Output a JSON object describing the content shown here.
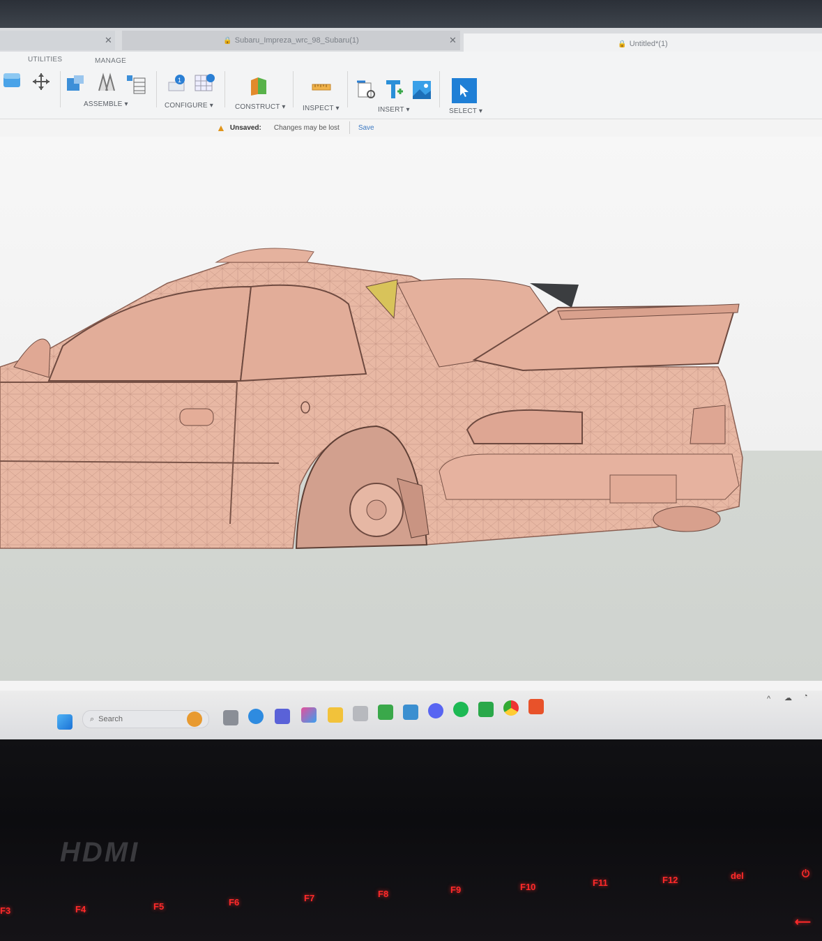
{
  "tabs": [
    {
      "label": ""
    },
    {
      "label": "Subaru_Impreza_wrc_98_Subaru(1)"
    },
    {
      "label": "Untitled*(1)"
    }
  ],
  "toolbar": {
    "top_labels": {
      "utilities": "UTILITIES",
      "manage": "MANAGE"
    },
    "groups": {
      "assemble": "ASSEMBLE ▾",
      "configure": "CONFIGURE ▾",
      "construct": "CONSTRUCT ▾",
      "inspect": "INSPECT ▾",
      "insert": "INSERT ▾",
      "select": "SELECT ▾"
    }
  },
  "status": {
    "unsaved_label": "Unsaved:",
    "message": "Changes may be lost",
    "save_link": "Save"
  },
  "taskbar": {
    "search_placeholder": "Search"
  },
  "laptop": {
    "hdmi_logo": "HDMI",
    "function_keys": [
      "F3",
      "F4",
      "F5",
      "F6",
      "F7",
      "F8",
      "F9",
      "F10",
      "F11",
      "F12",
      "del"
    ]
  },
  "colors": {
    "model_skin": "#e8b8a4",
    "mesh_line": "#b07e70",
    "accent_blue": "#1f7fd6",
    "key_backlight": "#ff2a2a"
  }
}
